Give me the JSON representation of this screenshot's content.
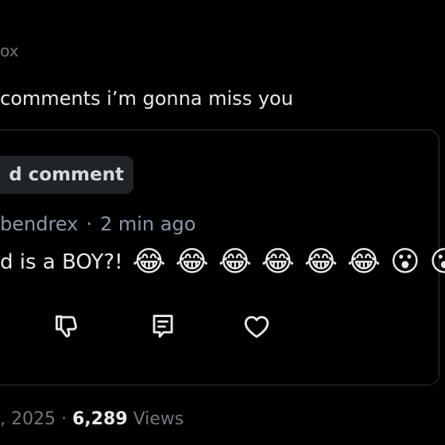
{
  "post": {
    "author_fragment": "ox",
    "text": "comments i’m gonna miss you"
  },
  "comment_section": {
    "add_comment_label": "d comment"
  },
  "comment": {
    "author": "bendrex",
    "separator": "·",
    "time_ago": "2 min ago",
    "text": "d is a BOY?!",
    "emojis": [
      "😂",
      "😂",
      "😂",
      "😂",
      "😂",
      "😂",
      "😮",
      "😮"
    ]
  },
  "actions": {
    "dislike_icon": "thumbs-down-icon",
    "reply_icon": "comment-icon",
    "like_icon": "heart-icon"
  },
  "footer": {
    "date_fragment": ", 2025",
    "separator": "·",
    "views_count": "6,289",
    "views_label": "Views"
  },
  "colors": {
    "background": "#000000",
    "primary_text": "#e7e9ea",
    "secondary_text": "#71767b",
    "button_bg": "#202327",
    "border": "#2f3336"
  }
}
